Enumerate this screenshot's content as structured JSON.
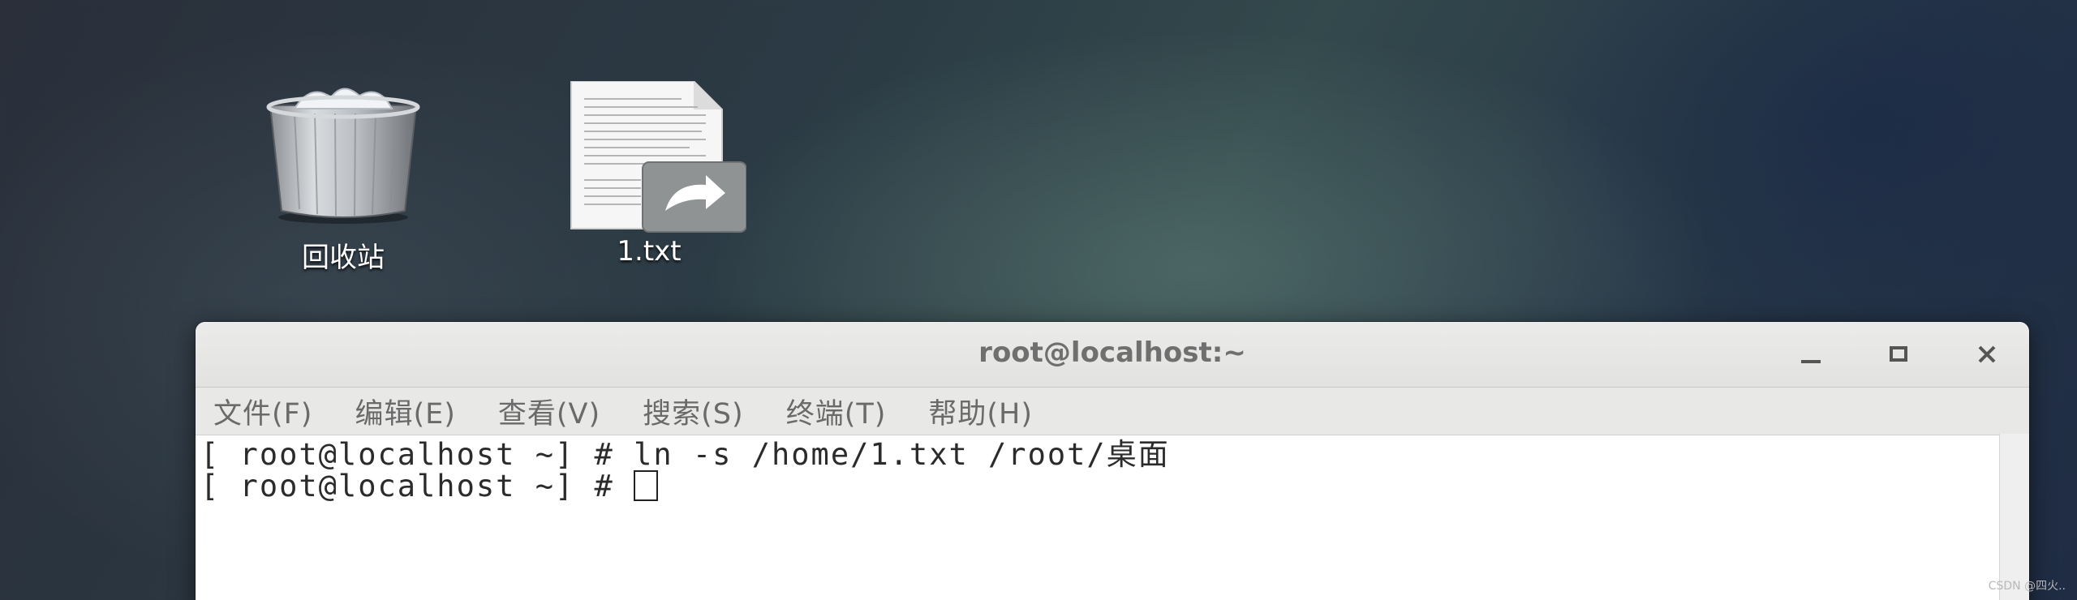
{
  "desktop": {
    "icons": [
      {
        "name": "trash",
        "label": "回收站",
        "icon": "trash-icon"
      },
      {
        "name": "file",
        "label": "1.txt",
        "icon": "text-file-link-icon"
      }
    ]
  },
  "terminal": {
    "title": "root@localhost:~",
    "controls": {
      "minimize": "—",
      "maximize": "□",
      "close": "✕"
    },
    "menu": [
      "文件(F)",
      "编辑(E)",
      "查看(V)",
      "搜索(S)",
      "终端(T)",
      "帮助(H)"
    ],
    "lines": [
      "[ root@localhost ~] # ln -s /home/1.txt /root/桌面",
      "[ root@localhost ~] # "
    ]
  },
  "watermark": "CSDN @四火.."
}
